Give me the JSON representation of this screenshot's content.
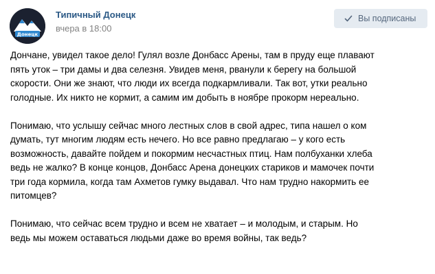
{
  "post": {
    "author": "Типичный Донецк",
    "time": "вчера в 18:00",
    "subscribe_label": "Вы подписаны",
    "avatar_text": "Донецк",
    "paragraphs": [
      [
        "Дончане, увидел такое дело! Гулял возле Донбасс Арены, там в пруду еще плавают",
        "пять уток – три дамы и два селезня. Увидев меня, рванули к берегу на большой",
        "скорости. Они же знают, что люди их всегда подкармливали. Так вот, утки реально",
        "голодные. Их никто не кормит, а самим им добыть в ноябре прокорм нереально."
      ],
      [
        "Понимаю, что услышу сейчас много лестных слов в свой адрес, типа нашел о ком",
        "думать, тут многим людям есть нечего. Но все равно предлагаю – у кого есть",
        "возможность, давайте пойдем и покормим несчастных птиц. Нам полбуханки хлеба",
        "ведь не жалко? В конце концов, Донбасс Арена донецких стариков и мамочек почти",
        "три года кормила, когда там Ахметов гумку выдавал. Что нам трудно накормить ее",
        "питомцев?"
      ],
      [
        "Понимаю, что сейчас всем трудно и всем не хватает – и молодым, и старым. Но",
        "ведь мы можем оставаться людьми даже во время войны, так ведь?"
      ]
    ]
  },
  "colors": {
    "author_link": "#2a5885",
    "time_text": "#828282",
    "button_bg": "#e5ebf1",
    "button_text": "#55677d"
  },
  "icons": {
    "subscribe_check": "check-icon",
    "avatar": "mountains-logo"
  }
}
